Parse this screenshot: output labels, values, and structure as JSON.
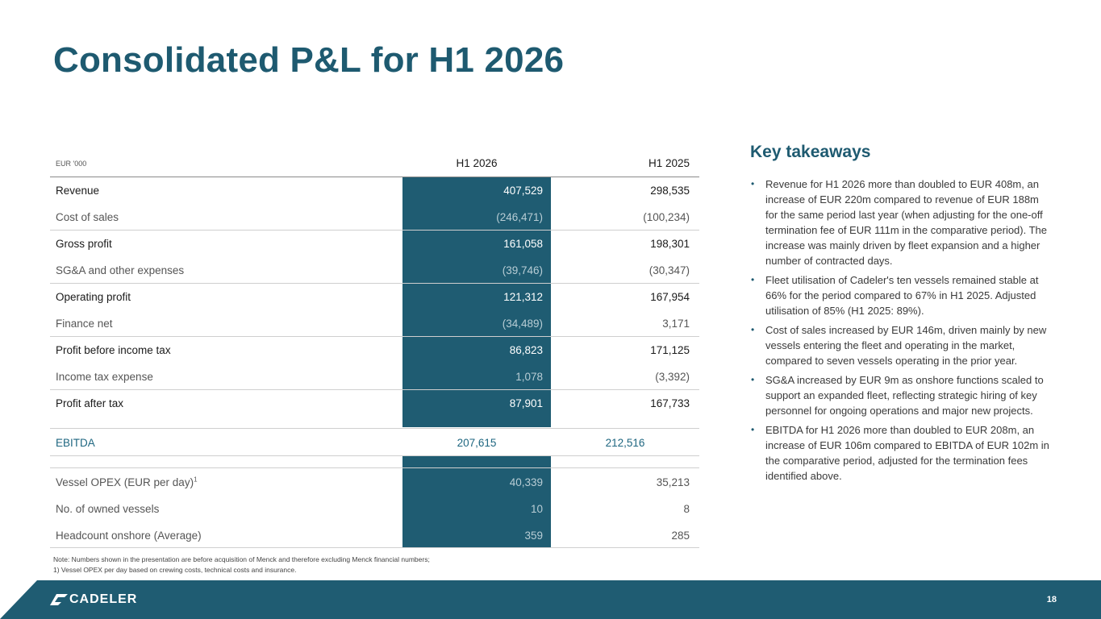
{
  "page": {
    "title": "Consolidated P&L for H1 2026",
    "page_number": "18",
    "logo_text": "CADELER"
  },
  "table": {
    "unit_label": "EUR '000",
    "col_h1_2026": "H1 2026",
    "col_h1_2025": "H1 2025",
    "rows": [
      {
        "label": "Revenue",
        "h1_2026": "407,529",
        "h1_2025": "298,535"
      },
      {
        "label": "Cost of sales",
        "h1_2026": "(246,471)",
        "h1_2025": "(100,234)"
      },
      {
        "label": "Gross profit",
        "h1_2026": "161,058",
        "h1_2025": "198,301"
      },
      {
        "label": "SG&A and other expenses",
        "h1_2026": "(39,746)",
        "h1_2025": "(30,347)"
      },
      {
        "label": "Operating profit",
        "h1_2026": "121,312",
        "h1_2025": "167,954"
      },
      {
        "label": "Finance net",
        "h1_2026": "(34,489)",
        "h1_2025": "3,171"
      },
      {
        "label": "Profit before income tax",
        "h1_2026": "86,823",
        "h1_2025": "171,125"
      },
      {
        "label": "Income tax expense",
        "h1_2026": "1,078",
        "h1_2025": "(3,392)"
      },
      {
        "label": "Profit after tax",
        "h1_2026": "87,901",
        "h1_2025": "167,733"
      },
      {
        "label": "EBITDA",
        "h1_2026": "207,615",
        "h1_2025": "212,516"
      },
      {
        "label": "Vessel OPEX (EUR per day)",
        "label_sup": "1",
        "h1_2026": "40,339",
        "h1_2025": "35,213"
      },
      {
        "label": "No. of owned vessels",
        "h1_2026": "10",
        "h1_2025": "8"
      },
      {
        "label": "Headcount onshore (Average)",
        "h1_2026": "359",
        "h1_2025": "285"
      }
    ]
  },
  "notes": {
    "line1": "Note: Numbers shown in the presentation are before acquisition of Menck and therefore excluding Menck financial numbers;",
    "line2": "1) Vessel OPEX per day based on crewing costs, technical costs and insurance."
  },
  "takeaways": {
    "title": "Key takeaways",
    "bullet": "•",
    "items": [
      "Revenue for H1 2026 more than doubled to EUR 408m, an increase of EUR 220m compared to revenue of EUR 188m for the same period last year (when adjusting for the one-off termination fee of EUR 111m in the comparative period). The increase was mainly driven by fleet expansion and a higher number of contracted days.",
      "Fleet utilisation of Cadeler's ten vessels remained stable at 66% for the period compared to 67% in H1 2025. Adjusted utilisation of 85% (H1 2025: 89%).",
      "Cost of sales increased by EUR 146m, driven mainly by new vessels entering the fleet and operating in the market, compared to seven vessels operating in the prior year.",
      "SG&A increased by EUR 9m as onshore functions scaled to support an expanded fleet, reflecting strategic hiring of key personnel for ongoing operations and major new projects.",
      "EBITDA for H1 2026 more than doubled to EUR 208m, an increase of EUR 106m compared to EBITDA of EUR 102m in the comparative period, adjusted for the termination fees identified above."
    ]
  },
  "colors": {
    "brand": "#1f5c72",
    "title": "#1e5a70",
    "accent_text": "#1e6680"
  }
}
